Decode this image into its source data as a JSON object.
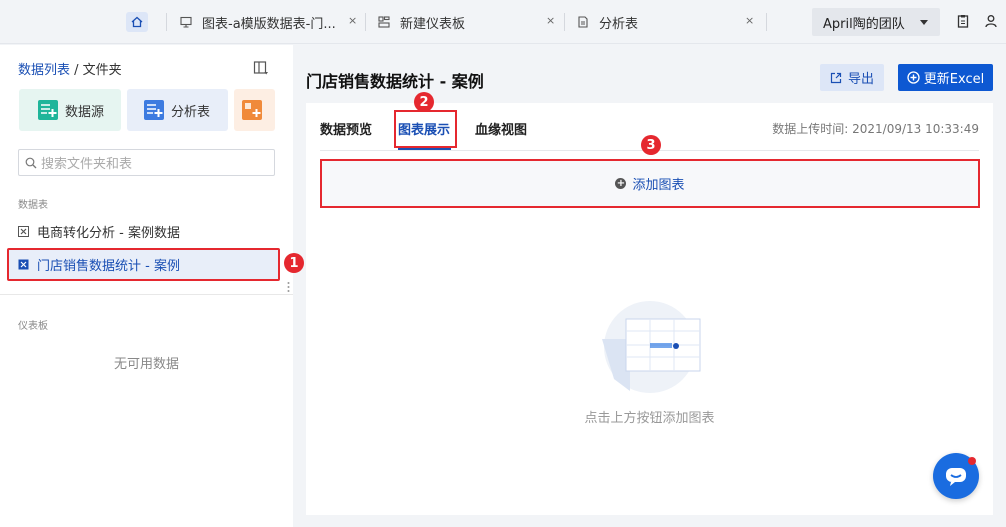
{
  "topbar": {
    "tabs": [
      {
        "label": "图表-a模版数据表-门...",
        "icon": "dashboard-screen-icon"
      },
      {
        "label": "新建仪表板",
        "icon": "dashboard-layout-icon"
      },
      {
        "label": "分析表",
        "icon": "document-icon"
      }
    ],
    "close_glyph": "×",
    "team": "April陶的团队"
  },
  "sidebar": {
    "title_part1": "数据列表",
    "title_sep": " / ",
    "title_part2": "文件夹",
    "quick_buttons": [
      {
        "label": "数据源",
        "color": "#1fb59a"
      },
      {
        "label": "分析表",
        "color": "#3d7be0"
      }
    ],
    "search_placeholder": "搜索文件夹和表",
    "section_tables": "数据表",
    "tables": [
      "电商转化分析 - 案例数据",
      "门店销售数据统计 - 案例"
    ],
    "section_dashboards": "仪表板",
    "dashboards_empty": "无可用数据"
  },
  "main": {
    "title": "门店销售数据统计 - 案例",
    "export_label": "导出",
    "update_label": "更新Excel",
    "tabs": [
      "数据预览",
      "图表展示",
      "血缘视图"
    ],
    "active_tab": "图表展示",
    "upload_time": "数据上传时间: 2021/09/13 10:33:49",
    "add_chart_label": "添加图表",
    "empty_hint": "点击上方按钮添加图表"
  },
  "annotations": [
    "1",
    "2",
    "3"
  ],
  "colors": {
    "accent": "#1a4fb4",
    "primary_btn": "#0d58d2",
    "highlight": "#e5282f"
  }
}
